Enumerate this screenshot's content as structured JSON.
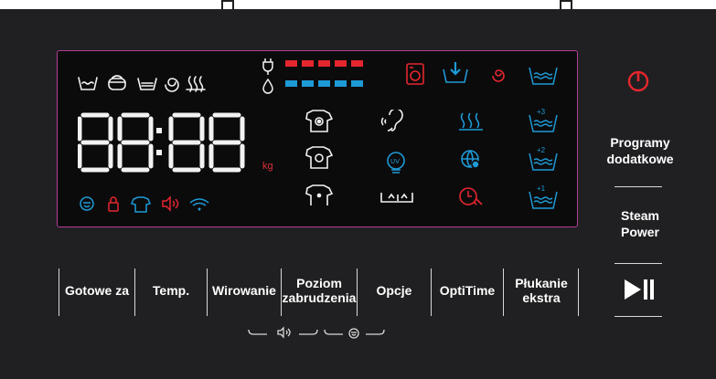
{
  "display": {
    "clock": [
      "8",
      "8",
      "8",
      "8"
    ],
    "weight_unit": "kg",
    "level_bars": {
      "power_count": 5,
      "water_count": 5,
      "power_color": "#e6262e",
      "water_color": "#1e9ad6"
    }
  },
  "buttons": {
    "programs_label": "Programy dodatkowe",
    "steam_label": "Steam Power",
    "options": [
      "Gotowe za",
      "Temp.",
      "Wirowanie",
      "Poziom zabrudzenia",
      "Opcje",
      "OptiTime",
      "Płukanie ekstra"
    ]
  },
  "rinse_levels": [
    "+3",
    "+2",
    "+1"
  ],
  "colors": {
    "red": "#e6262e",
    "blue": "#1e9ad6",
    "white": "#f2f2f2",
    "magenta_border": "#b43c9a"
  },
  "icons": [
    "power-icon",
    "play-pause-icon",
    "sound-icon",
    "child-lock-icon"
  ]
}
